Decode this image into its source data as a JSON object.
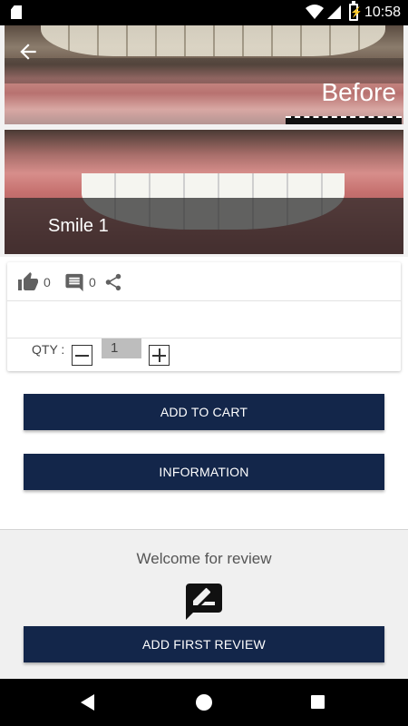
{
  "status_bar": {
    "time": "10:58",
    "battery_icon": "battery-charging-icon"
  },
  "gallery": {
    "before_label": "Before",
    "after_caption": "Smile 1"
  },
  "stats": {
    "likes": "0",
    "comments": "0"
  },
  "quantity": {
    "label": "QTY :",
    "value": "1"
  },
  "actions": {
    "add_to_cart": "ADD TO CART",
    "information": "INFORMATION"
  },
  "review": {
    "welcome": "Welcome for review",
    "add_first": "ADD FIRST REVIEW"
  },
  "colors": {
    "primary": "#13264a",
    "review_bg": "#f0f0f0"
  }
}
